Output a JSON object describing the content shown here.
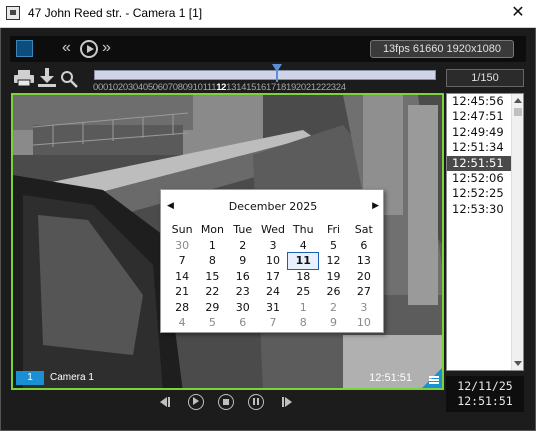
{
  "window": {
    "title": "47 John Reed str. - Camera 1 [1]",
    "close_glyph": "✕"
  },
  "toolbar": {
    "rewind_glyph": "«",
    "forward_glyph": "»",
    "fps_info": "13fps  61660 1920x1080"
  },
  "timeline": {
    "hours_before": "0001020304050607080910111",
    "hour_current": "12",
    "hours_after": "131415161718192021222324",
    "counter": "1/150"
  },
  "video": {
    "camera_number": "1",
    "camera_label": "Camera 1",
    "timestamp": "12:51:51"
  },
  "calendar": {
    "prev_glyph": "◀",
    "next_glyph": "▶",
    "month_year": "December 2025",
    "weekdays": [
      "Sun",
      "Mon",
      "Tue",
      "Wed",
      "Thu",
      "Fri",
      "Sat"
    ],
    "weeks": [
      [
        "30",
        "1",
        "2",
        "3",
        "4",
        "5",
        "6"
      ],
      [
        "7",
        "8",
        "9",
        "10",
        "11",
        "12",
        "13"
      ],
      [
        "14",
        "15",
        "16",
        "17",
        "18",
        "19",
        "20"
      ],
      [
        "21",
        "22",
        "23",
        "24",
        "25",
        "26",
        "27"
      ],
      [
        "28",
        "29",
        "30",
        "31",
        "1",
        "2",
        "3"
      ],
      [
        "4",
        "5",
        "6",
        "7",
        "8",
        "9",
        "10"
      ]
    ],
    "selected_day": "11"
  },
  "time_list": {
    "items": [
      "12:45:56",
      "12:47:51",
      "12:49:49",
      "12:51:34",
      "12:51:51",
      "12:52:06",
      "12:52:25",
      "12:53:30"
    ],
    "selected": "12:51:51"
  },
  "datetime": {
    "date": "12/11/25",
    "time": "12:51:51"
  },
  "colors": {
    "video_border": "#7bd33a",
    "accent_blue": "#1b8fd3",
    "selected_row": "#4a4a4a"
  }
}
